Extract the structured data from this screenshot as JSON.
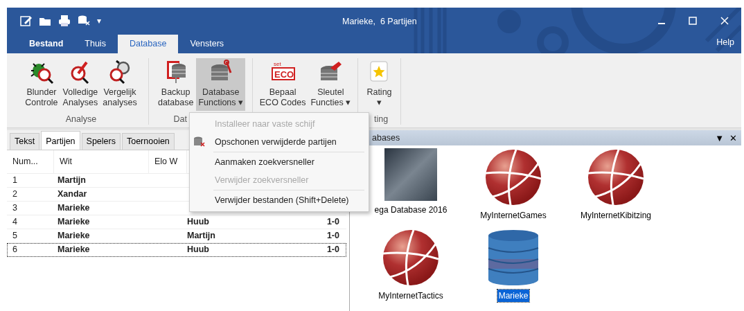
{
  "window": {
    "title": "Marieke,  6 Partijen"
  },
  "quick_access": [
    {
      "kind": "edit"
    },
    {
      "kind": "folder"
    },
    {
      "kind": "print"
    },
    {
      "kind": "dbx"
    },
    {
      "kind": "more",
      "label": "▾"
    }
  ],
  "ribbon_tabs": [
    {
      "label": "Bestand",
      "selected": false,
      "kind": "file"
    },
    {
      "label": "Thuis",
      "selected": false,
      "kind": "tab"
    },
    {
      "label": "Database",
      "selected": true,
      "kind": "tab"
    },
    {
      "label": "Vensters",
      "selected": false,
      "kind": "tab"
    }
  ],
  "help": "Help",
  "ribbon_groups": [
    {
      "label": "Analyse",
      "buttons": [
        {
          "label": "Blunder Controle",
          "pressed": false
        },
        {
          "label": "Volledige Analyses",
          "pressed": false
        },
        {
          "label": "Vergelijk analyses",
          "pressed": false
        }
      ]
    },
    {
      "label": "Dat",
      "buttons": [
        {
          "label": "Backup database",
          "pressed": false
        },
        {
          "label": "Database Functions",
          "caret": "▾",
          "pressed": true
        }
      ]
    },
    {
      "buttons": [
        {
          "label": "Bepaal ECO Codes",
          "icon_text": [
            "set",
            "ECO"
          ],
          "pressed": false
        },
        {
          "label": "Sleutel Functies",
          "caret": "▾",
          "pressed": false
        }
      ]
    },
    {
      "label": "ting",
      "buttons": [
        {
          "label": "Rating",
          "caret": "▾",
          "pressed": false
        }
      ]
    }
  ],
  "menu": {
    "items": [
      {
        "kind": "item",
        "label": "Installeer naar vaste schijf",
        "disabled": true,
        "icon": false
      },
      {
        "kind": "item",
        "label": "Opschonen verwijderde partijen",
        "disabled": false,
        "icon": true
      },
      {
        "kind": "separator"
      },
      {
        "kind": "item",
        "label": "Aanmaken zoekversneller",
        "disabled": false,
        "icon": false
      },
      {
        "kind": "item",
        "label": "Verwijder zoekversneller",
        "disabled": true,
        "icon": false
      },
      {
        "kind": "separator"
      },
      {
        "kind": "item",
        "label": "Verwijder bestanden (Shift+Delete)",
        "disabled": false,
        "icon": false
      }
    ]
  },
  "left_panel": {
    "tabs": [
      {
        "label": "Tekst",
        "selected": false
      },
      {
        "label": "Partijen",
        "selected": true
      },
      {
        "label": "Spelers",
        "selected": false
      },
      {
        "label": "Toernooien",
        "selected": false
      }
    ],
    "table": {
      "columns": [
        "Num...",
        "Wit",
        "Elo W"
      ],
      "rows": [
        {
          "num": "1",
          "wit": "Martijn",
          "focused": false
        },
        {
          "num": "2",
          "wit": "Xandar",
          "focused": false
        },
        {
          "num": "3",
          "wit": "Marieke",
          "focused": false
        },
        {
          "num": "4",
          "wit": "Marieke",
          "zwart": "Huub",
          "result": "1-0",
          "focused": false
        },
        {
          "num": "5",
          "wit": "Marieke",
          "zwart": "Martijn",
          "result": "1-0",
          "focused": false
        },
        {
          "num": "6",
          "wit": "Marieke",
          "zwart": "Huub",
          "result": "1-0",
          "focused": true
        }
      ]
    }
  },
  "right_panel": {
    "title": "abases",
    "buttons": [
      "▼",
      "✕"
    ],
    "items": [
      {
        "kind": "photo",
        "label": "ega Database 2016",
        "selected": false
      },
      {
        "kind": "globe",
        "label": "MyInternetGames",
        "selected": false
      },
      {
        "kind": "globe",
        "label": "MyInternetKibitzing",
        "selected": false
      },
      {
        "kind": "globe",
        "label": "MyInternetTactics",
        "selected": false
      },
      {
        "kind": "cylinder",
        "label": "Marieke",
        "selected": true
      }
    ]
  }
}
